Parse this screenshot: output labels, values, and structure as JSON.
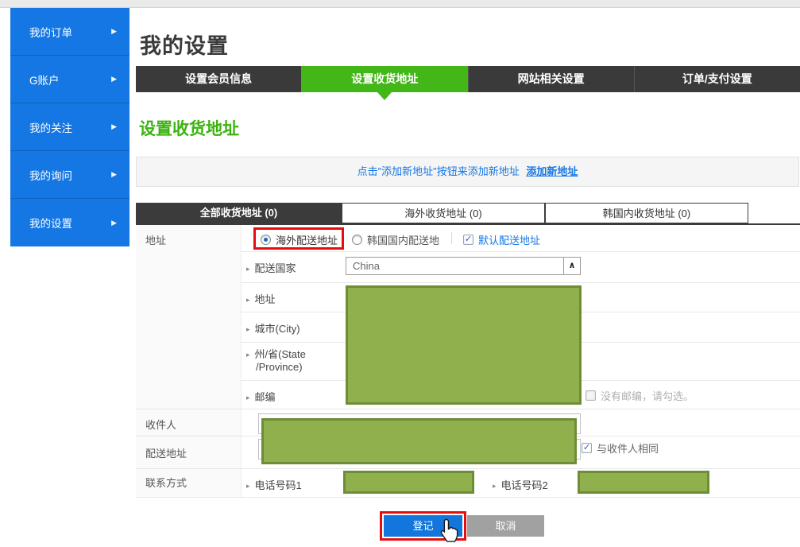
{
  "sidebar": {
    "items": [
      {
        "label": "我的订单"
      },
      {
        "label": "G账户"
      },
      {
        "label": "我的关注"
      },
      {
        "label": "我的询问"
      },
      {
        "label": "我的设置"
      }
    ]
  },
  "page": {
    "title": "我的设置"
  },
  "tabs": [
    {
      "label": "设置会员信息"
    },
    {
      "label": "设置收货地址"
    },
    {
      "label": "网站相关设置"
    },
    {
      "label": "订单/支付设置"
    }
  ],
  "section": {
    "title": "设置收货地址"
  },
  "notice": {
    "text": "点击\"添加新地址\"按钮来添加新地址",
    "link": "添加新地址"
  },
  "subtabs": [
    {
      "label": "全部收货地址 (0)"
    },
    {
      "label": "海外收货地址 (0)"
    },
    {
      "label": "韩国内收货地址 (0)"
    }
  ],
  "form": {
    "address_group_label": "地址",
    "radio_overseas": "海外配送地址",
    "radio_domestic": "韩国国内配送地",
    "default_checkbox": "默认配送地址",
    "country_label": "配送国家",
    "country_value": "China",
    "addr_label": "地址",
    "city_label": "城市(City)",
    "state_label_line1": "州/省(State",
    "state_label_line2": "/Province)",
    "zip_label": "邮编",
    "zip_checkbox": "没有邮编，请勾选。",
    "recipient_label": "收件人",
    "delivery_label": "配送地址",
    "same_checkbox": "与收件人相同",
    "contact_label": "联系方式",
    "phone1_label": "电话号码1",
    "phone2_label": "电话号码2"
  },
  "buttons": {
    "submit": "登记",
    "cancel": "取消"
  },
  "icons": {
    "chevron_right": "▶",
    "bullet": "▸",
    "caret_up": "∧",
    "check": "✓"
  },
  "colors": {
    "sidebar_blue": "#1577e4",
    "tab_green": "#43b717",
    "heading_green": "#3bb30f",
    "link_blue": "#1577e4",
    "redaction_fill": "#8fb04d",
    "redaction_border": "#6d8d37",
    "annotation_red": "#e50d0d",
    "submit_blue": "#1276dd",
    "cancel_gray": "#a1a1a1"
  }
}
